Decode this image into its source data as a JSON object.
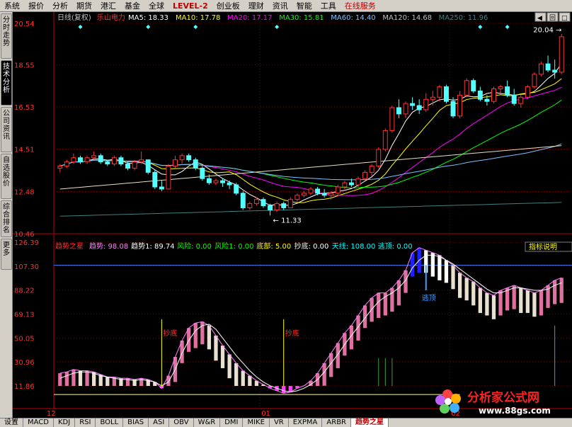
{
  "menu": [
    "系统",
    "报价",
    "分析",
    "期货",
    "港汇",
    "基金",
    "全球",
    "LEVEL-2",
    "创业板",
    "理财",
    "资讯",
    "智能",
    "工具",
    "在线服务"
  ],
  "sidebar_tabs": [
    {
      "label": "分时走势",
      "active": false
    },
    {
      "label": "技术分析",
      "active": true
    },
    {
      "label": "公司资讯",
      "active": false
    },
    {
      "label": "自选股价",
      "active": false
    },
    {
      "label": "综合排名",
      "active": false
    },
    {
      "label": "更多",
      "active": false
    }
  ],
  "top_right_buttons": [
    "◀",
    "回",
    "□"
  ],
  "main_header": {
    "period": "日线(复权)",
    "stock": "乐山电力",
    "ma": [
      {
        "label": "MA5:",
        "value": "18.33",
        "color": "#ffffff"
      },
      {
        "label": "MA10:",
        "value": "17.78",
        "color": "#ffff00"
      },
      {
        "label": "MA20:",
        "value": "17.17",
        "color": "#ff00ff"
      },
      {
        "label": "MA30:",
        "value": "15.81",
        "color": "#00ff00"
      },
      {
        "label": "MA60:",
        "value": "14.40",
        "color": "#80c0ff"
      },
      {
        "label": "MA120:",
        "value": "14.68",
        "color": "#c0c0c0"
      },
      {
        "label": "MA250:",
        "value": "11.96",
        "color": "#408080"
      }
    ]
  },
  "main_axis": [
    "20.54",
    "18.55",
    "16.53",
    "14.51",
    "12.48",
    "10.46"
  ],
  "price_annotations": {
    "high": "20.04",
    "low": "11.33"
  },
  "indicator_header": {
    "name": "趋势之星",
    "items": [
      {
        "label": "趋势:",
        "value": "98.08",
        "color": "#ff80ff"
      },
      {
        "label": "趋势1:",
        "value": "89.74",
        "color": "#ffffff"
      },
      {
        "label": "风险:",
        "value": "0.00",
        "color": "#00ff00"
      },
      {
        "label": "风险1:",
        "value": "0.00",
        "color": "#00ff00"
      },
      {
        "label": "底部:",
        "value": "5.00",
        "color": "#ffff00"
      },
      {
        "label": "抄底:",
        "value": "0.00",
        "color": "#ffffff"
      },
      {
        "label": "天线:",
        "value": "108.00",
        "color": "#00ffff"
      },
      {
        "label": "逃顶:",
        "value": "0.00",
        "color": "#00ffff"
      }
    ],
    "help": "指标说明"
  },
  "indicator_axis": [
    "126.39",
    "107.30",
    "88.22",
    "69.13",
    "50.05",
    "30.96",
    "11.86"
  ],
  "indicator_labels": {
    "bottom1": "抄底",
    "bottom2": "抄底",
    "top": "逃顶"
  },
  "date_axis": [
    "12",
    "01",
    "02"
  ],
  "bottom_tabs": [
    "设置",
    "MACD",
    "KDJ",
    "RSI",
    "BOLL",
    "BIAS",
    "ASI",
    "OBV",
    "W&R",
    "DMI",
    "MIKE",
    "VR",
    "EXPMA",
    "ARBR",
    "趋势之星"
  ],
  "bottom_tab_active": "趋势之星",
  "logo": {
    "text": "分析家公式网",
    "url": "www.88gs.com"
  },
  "chart_data": {
    "type": "candlestick",
    "ohlc": [
      [
        13.6,
        13.8,
        13.4,
        13.7
      ],
      [
        13.7,
        14.0,
        13.6,
        13.9
      ],
      [
        13.9,
        14.3,
        13.8,
        14.1
      ],
      [
        14.1,
        14.2,
        13.8,
        13.9
      ],
      [
        13.9,
        14.2,
        13.8,
        14.1
      ],
      [
        14.1,
        14.4,
        14.0,
        14.2
      ],
      [
        14.2,
        14.3,
        13.8,
        13.9
      ],
      [
        13.9,
        14.0,
        13.7,
        13.8
      ],
      [
        13.8,
        14.2,
        13.7,
        14.1
      ],
      [
        14.1,
        14.2,
        13.7,
        13.8
      ],
      [
        13.8,
        13.9,
        13.5,
        13.6
      ],
      [
        13.6,
        14.0,
        13.5,
        13.9
      ],
      [
        13.9,
        14.4,
        13.8,
        14.0
      ],
      [
        14.0,
        14.0,
        13.3,
        13.4
      ],
      [
        13.4,
        13.5,
        12.6,
        12.7
      ],
      [
        12.7,
        13.0,
        12.5,
        12.6
      ],
      [
        12.6,
        13.8,
        12.6,
        13.7
      ],
      [
        13.7,
        14.2,
        13.6,
        14.0
      ],
      [
        14.0,
        14.3,
        13.8,
        14.2
      ],
      [
        14.2,
        14.3,
        13.9,
        14.0
      ],
      [
        14.0,
        14.1,
        13.5,
        13.6
      ],
      [
        13.6,
        13.7,
        13.0,
        13.1
      ],
      [
        13.1,
        13.3,
        12.8,
        12.9
      ],
      [
        12.9,
        13.1,
        12.8,
        13.0
      ],
      [
        13.0,
        13.1,
        12.7,
        12.9
      ],
      [
        12.9,
        13.0,
        12.6,
        12.8
      ],
      [
        12.8,
        12.9,
        12.3,
        12.4
      ],
      [
        12.4,
        12.5,
        11.6,
        11.7
      ],
      [
        11.7,
        12.0,
        11.6,
        11.9
      ],
      [
        11.9,
        12.2,
        11.8,
        12.1
      ],
      [
        12.1,
        12.2,
        11.7,
        11.8
      ],
      [
        11.8,
        11.9,
        11.33,
        11.6
      ],
      [
        11.6,
        12.0,
        11.5,
        11.9
      ],
      [
        11.9,
        12.0,
        11.6,
        11.7
      ],
      [
        11.7,
        12.2,
        11.7,
        12.1
      ],
      [
        12.1,
        12.4,
        12.0,
        12.3
      ],
      [
        12.3,
        12.5,
        12.2,
        12.4
      ],
      [
        12.4,
        12.7,
        12.3,
        12.6
      ],
      [
        12.6,
        12.7,
        12.3,
        12.4
      ],
      [
        12.4,
        12.6,
        12.2,
        12.3
      ],
      [
        12.3,
        12.5,
        12.1,
        12.4
      ],
      [
        12.4,
        12.8,
        12.3,
        12.7
      ],
      [
        12.7,
        13.0,
        12.6,
        12.9
      ],
      [
        12.9,
        13.1,
        12.7,
        12.8
      ],
      [
        12.8,
        13.2,
        12.7,
        13.1
      ],
      [
        13.1,
        13.5,
        13.0,
        13.4
      ],
      [
        13.4,
        13.8,
        13.2,
        13.7
      ],
      [
        13.7,
        14.6,
        13.6,
        14.5
      ],
      [
        14.5,
        15.5,
        14.4,
        15.4
      ],
      [
        15.4,
        16.6,
        15.3,
        16.5
      ],
      [
        16.5,
        16.9,
        16.0,
        16.2
      ],
      [
        16.2,
        16.8,
        16.0,
        16.7
      ],
      [
        16.7,
        17.0,
        16.4,
        16.6
      ],
      [
        16.6,
        16.9,
        16.2,
        16.4
      ],
      [
        16.4,
        17.2,
        16.3,
        16.9
      ],
      [
        16.9,
        17.3,
        16.6,
        17.0
      ],
      [
        17.0,
        17.6,
        16.8,
        17.5
      ],
      [
        17.5,
        17.6,
        16.7,
        16.8
      ],
      [
        16.8,
        17.0,
        16.0,
        16.1
      ],
      [
        16.1,
        17.3,
        16.0,
        17.1
      ],
      [
        17.1,
        17.9,
        17.0,
        17.8
      ],
      [
        17.8,
        17.9,
        17.2,
        17.3
      ],
      [
        17.3,
        17.5,
        16.8,
        16.9
      ],
      [
        16.9,
        17.1,
        16.6,
        16.8
      ],
      [
        16.8,
        17.5,
        16.7,
        17.4
      ],
      [
        17.4,
        17.6,
        17.2,
        17.5
      ],
      [
        17.5,
        17.8,
        17.0,
        17.1
      ],
      [
        17.1,
        17.4,
        16.6,
        16.7
      ],
      [
        16.7,
        17.1,
        16.5,
        17.0
      ],
      [
        17.0,
        17.6,
        16.9,
        17.5
      ],
      [
        17.5,
        18.2,
        17.4,
        18.1
      ],
      [
        18.1,
        18.7,
        18.0,
        18.6
      ],
      [
        18.6,
        19.0,
        18.2,
        18.3
      ],
      [
        18.3,
        18.8,
        17.9,
        18.2
      ],
      [
        18.2,
        20.04,
        18.1,
        19.9
      ]
    ],
    "trend": [
      22,
      23,
      25,
      24,
      24,
      23,
      21,
      19,
      19,
      18,
      18,
      17,
      18,
      17,
      15,
      10,
      20,
      35,
      48,
      58,
      62,
      63,
      60,
      52,
      44,
      37,
      30,
      24,
      20,
      16,
      13,
      10,
      8,
      6,
      7,
      10,
      12,
      16,
      22,
      30,
      38,
      46,
      54,
      60,
      68,
      76,
      82,
      86,
      86,
      90,
      96,
      104,
      118,
      122,
      120,
      118,
      116,
      112,
      108,
      102,
      98,
      95,
      90,
      86,
      84,
      88,
      90,
      92,
      90,
      88,
      86,
      88,
      92,
      96,
      98
    ],
    "trend1": [
      18,
      20,
      22,
      23,
      23,
      22,
      20,
      19,
      18,
      17,
      17,
      16,
      17,
      16,
      15,
      12,
      15,
      25,
      38,
      48,
      56,
      60,
      61,
      57,
      50,
      43,
      36,
      30,
      24,
      19,
      15,
      12,
      10,
      8,
      7,
      8,
      10,
      13,
      17,
      23,
      30,
      37,
      45,
      52,
      59,
      66,
      73,
      79,
      83,
      86,
      90,
      96,
      106,
      112,
      116,
      116,
      115,
      112,
      109,
      105,
      101,
      97,
      93,
      89,
      86,
      86,
      88,
      90,
      90,
      89,
      88,
      88,
      89,
      92,
      94
    ]
  }
}
